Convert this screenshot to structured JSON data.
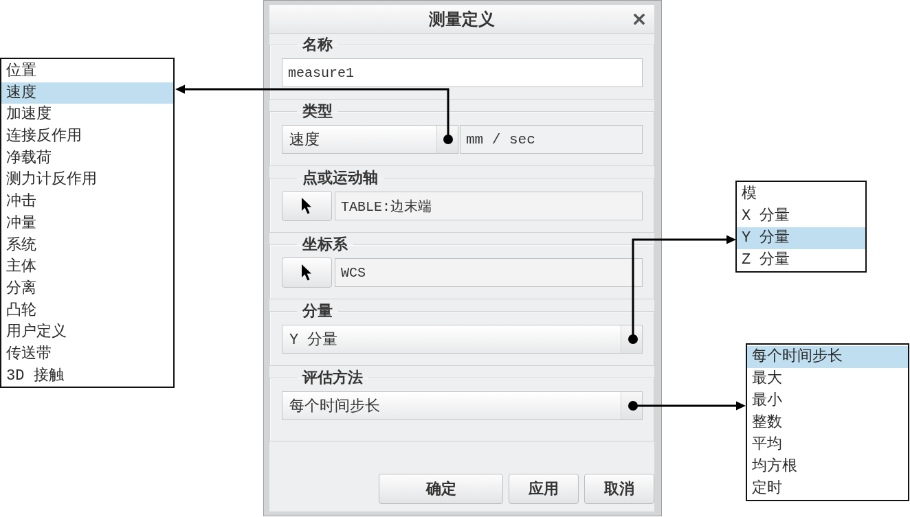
{
  "dialog": {
    "title": "测量定义",
    "groups": [
      {
        "kind": "text",
        "label": "名称",
        "value": "measure1"
      },
      {
        "kind": "combo_unit",
        "label": "类型",
        "value": "速度",
        "unit": "mm / sec"
      },
      {
        "kind": "pick",
        "label": "点或运动轴",
        "value": "TABLE:边末端"
      },
      {
        "kind": "pick",
        "label": "坐标系",
        "value": "WCS"
      },
      {
        "kind": "combo",
        "label": "分量",
        "value": "Y 分量"
      },
      {
        "kind": "combo",
        "label": "评估方法",
        "value": "每个时间步长"
      }
    ],
    "buttons": [
      "确定",
      "应用",
      "取消"
    ]
  },
  "lists": [
    {
      "items": [
        {
          "label": "位置",
          "selected": false
        },
        {
          "label": "速度",
          "selected": true
        },
        {
          "label": "加速度",
          "selected": false
        },
        {
          "label": "连接反作用",
          "selected": false
        },
        {
          "label": "净载荷",
          "selected": false
        },
        {
          "label": "测力计反作用",
          "selected": false
        },
        {
          "label": "冲击",
          "selected": false
        },
        {
          "label": "冲量",
          "selected": false
        },
        {
          "label": "系统",
          "selected": false
        },
        {
          "label": "主体",
          "selected": false
        },
        {
          "label": "分离",
          "selected": false
        },
        {
          "label": "凸轮",
          "selected": false
        },
        {
          "label": "用户定义",
          "selected": false
        },
        {
          "label": "传送带",
          "selected": false
        },
        {
          "label": "3D 接触",
          "selected": false
        }
      ]
    },
    {
      "items": [
        {
          "label": "模",
          "selected": false
        },
        {
          "label": "X 分量",
          "selected": false
        },
        {
          "label": "Y 分量",
          "selected": true
        },
        {
          "label": "Z 分量",
          "selected": false
        }
      ]
    },
    {
      "items": [
        {
          "label": "每个时间步长",
          "selected": true
        },
        {
          "label": "最大",
          "selected": false
        },
        {
          "label": "最小",
          "selected": false
        },
        {
          "label": "整数",
          "selected": false
        },
        {
          "label": "平均",
          "selected": false
        },
        {
          "label": "均方根",
          "selected": false
        },
        {
          "label": "定时",
          "selected": false
        }
      ]
    }
  ]
}
